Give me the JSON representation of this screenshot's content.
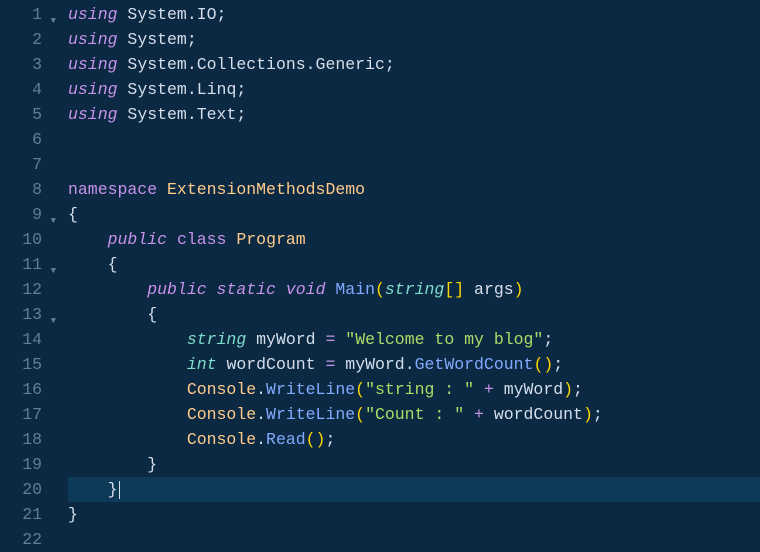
{
  "lineCount": 22,
  "foldLines": [
    1,
    9,
    11,
    13
  ],
  "activeLine": 20,
  "code": {
    "using": "using",
    "ns1": "System.IO",
    "ns2": "System",
    "ns3": "System.Collections.Generic",
    "ns4": "System.Linq",
    "ns5": "System.Text",
    "namespace": "namespace",
    "nsName": "ExtensionMethodsDemo",
    "public": "public",
    "class": "class",
    "className": "Program",
    "static": "static",
    "void": "void",
    "mainName": "Main",
    "stringType": "string",
    "argsName": "args",
    "intType": "int",
    "var1": "myWord",
    "str1": "\"Welcome to my blog\"",
    "var2": "wordCount",
    "getWordCount": "GetWordCount",
    "console": "Console",
    "writeLine": "WriteLine",
    "read": "Read",
    "str2": "\"string : \"",
    "str3": "\"Count : \""
  }
}
